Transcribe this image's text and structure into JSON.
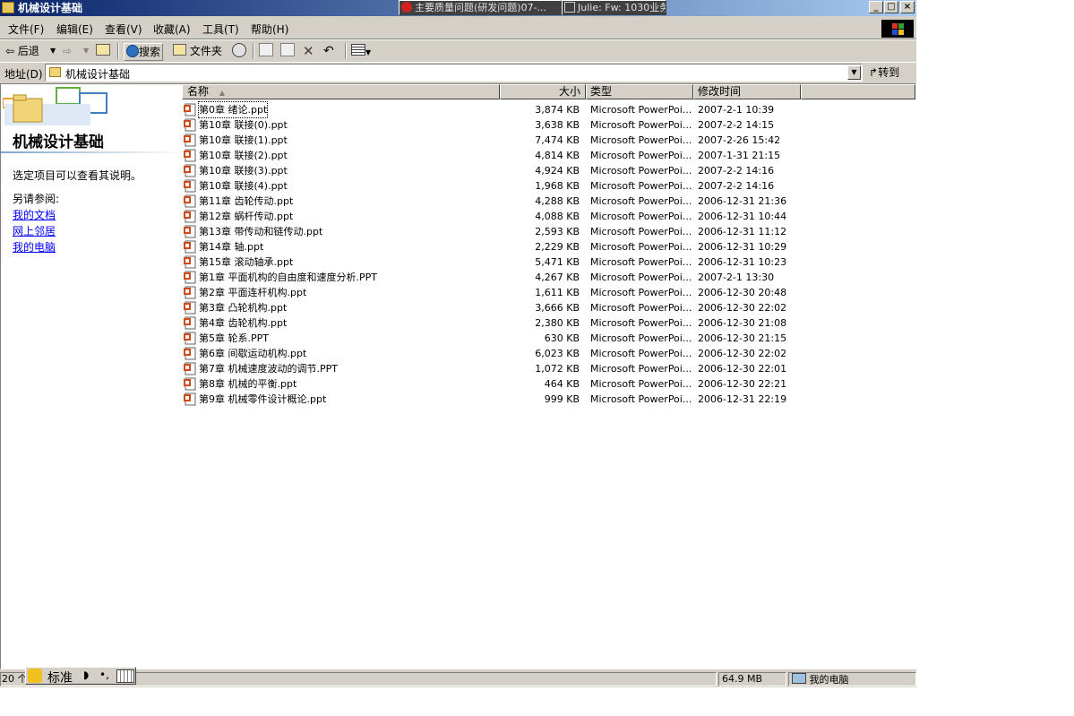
{
  "window": {
    "title": "机械设计基础",
    "taskbar_items": [
      {
        "label": "主要质量问题(研发问题)07-..."
      },
      {
        "label": "Julie: Fw: 1030业务"
      }
    ],
    "buttons": {
      "minimize": "_",
      "maximize": "□",
      "close": "×"
    }
  },
  "menubar": {
    "items": [
      "文件(F)",
      "编辑(E)",
      "查看(V)",
      "收藏(A)",
      "工具(T)",
      "帮助(H)"
    ]
  },
  "toolbar": {
    "back": "后退",
    "search": "搜索",
    "folders": "文件夹"
  },
  "address": {
    "label": "地址(D)",
    "value": "机械设计基础",
    "go": "转到"
  },
  "left_pane": {
    "title": "机械设计基础",
    "hint": "选定项目可以查看其说明。",
    "see_also": "另请参阅:",
    "links": [
      "我的文档",
      "网上邻居",
      "我的电脑"
    ]
  },
  "columns": {
    "name": "名称",
    "sort_arrow": "▲",
    "size": "大小",
    "type": "类型",
    "modified": "修改时间"
  },
  "files": [
    {
      "name": "第0章 绪论.ppt",
      "size": "3,874 KB",
      "type": "Microsoft PowerPoi...",
      "modified": "2007-2-1 10:39"
    },
    {
      "name": "第10章 联接(0).ppt",
      "size": "3,638 KB",
      "type": "Microsoft PowerPoi...",
      "modified": "2007-2-2 14:15"
    },
    {
      "name": "第10章 联接(1).ppt",
      "size": "7,474 KB",
      "type": "Microsoft PowerPoi...",
      "modified": "2007-2-26 15:42"
    },
    {
      "name": "第10章 联接(2).ppt",
      "size": "4,814 KB",
      "type": "Microsoft PowerPoi...",
      "modified": "2007-1-31 21:15"
    },
    {
      "name": "第10章 联接(3).ppt",
      "size": "4,924 KB",
      "type": "Microsoft PowerPoi...",
      "modified": "2007-2-2 14:16"
    },
    {
      "name": "第10章 联接(4).ppt",
      "size": "1,968 KB",
      "type": "Microsoft PowerPoi...",
      "modified": "2007-2-2 14:16"
    },
    {
      "name": "第11章 齿轮传动.ppt",
      "size": "4,288 KB",
      "type": "Microsoft PowerPoi...",
      "modified": "2006-12-31 21:36"
    },
    {
      "name": "第12章 蜗杆传动.ppt",
      "size": "4,088 KB",
      "type": "Microsoft PowerPoi...",
      "modified": "2006-12-31 10:44"
    },
    {
      "name": "第13章 带传动和链传动.ppt",
      "size": "2,593 KB",
      "type": "Microsoft PowerPoi...",
      "modified": "2006-12-31 11:12"
    },
    {
      "name": "第14章 轴.ppt",
      "size": "2,229 KB",
      "type": "Microsoft PowerPoi...",
      "modified": "2006-12-31 10:29"
    },
    {
      "name": "第15章 滚动轴承.ppt",
      "size": "5,471 KB",
      "type": "Microsoft PowerPoi...",
      "modified": "2006-12-31 10:23"
    },
    {
      "name": "第1章 平面机构的自由度和速度分析.PPT",
      "size": "4,267 KB",
      "type": "Microsoft PowerPoi...",
      "modified": "2007-2-1 13:30"
    },
    {
      "name": "第2章 平面连杆机构.ppt",
      "size": "1,611 KB",
      "type": "Microsoft PowerPoi...",
      "modified": "2006-12-30 20:48"
    },
    {
      "name": "第3章 凸轮机构.ppt",
      "size": "3,666 KB",
      "type": "Microsoft PowerPoi...",
      "modified": "2006-12-30 22:02"
    },
    {
      "name": "第4章 齿轮机构.ppt",
      "size": "2,380 KB",
      "type": "Microsoft PowerPoi...",
      "modified": "2006-12-30 21:08"
    },
    {
      "name": "第5章 轮系.PPT",
      "size": "630 KB",
      "type": "Microsoft PowerPoi...",
      "modified": "2006-12-30 21:15"
    },
    {
      "name": "第6章 间歇运动机构.ppt",
      "size": "6,023 KB",
      "type": "Microsoft PowerPoi...",
      "modified": "2006-12-30 22:02"
    },
    {
      "name": "第7章 机械速度波动的调节.PPT",
      "size": "1,072 KB",
      "type": "Microsoft PowerPoi...",
      "modified": "2006-12-30 22:01"
    },
    {
      "name": "第8章 机械的平衡.ppt",
      "size": "464 KB",
      "type": "Microsoft PowerPoi...",
      "modified": "2006-12-30 22:21"
    },
    {
      "name": "第9章 机械零件设计概论.ppt",
      "size": "999 KB",
      "type": "Microsoft PowerPoi...",
      "modified": "2006-12-31 22:19"
    }
  ],
  "status": {
    "count": "20 个",
    "size": "64.9 MB",
    "location": "我的电脑"
  },
  "ime": {
    "mode": "标准"
  },
  "colors": {
    "title_start": "#0a246a",
    "title_end": "#a6caf0",
    "chrome": "#d4d0c8",
    "link": "#0000ff"
  }
}
